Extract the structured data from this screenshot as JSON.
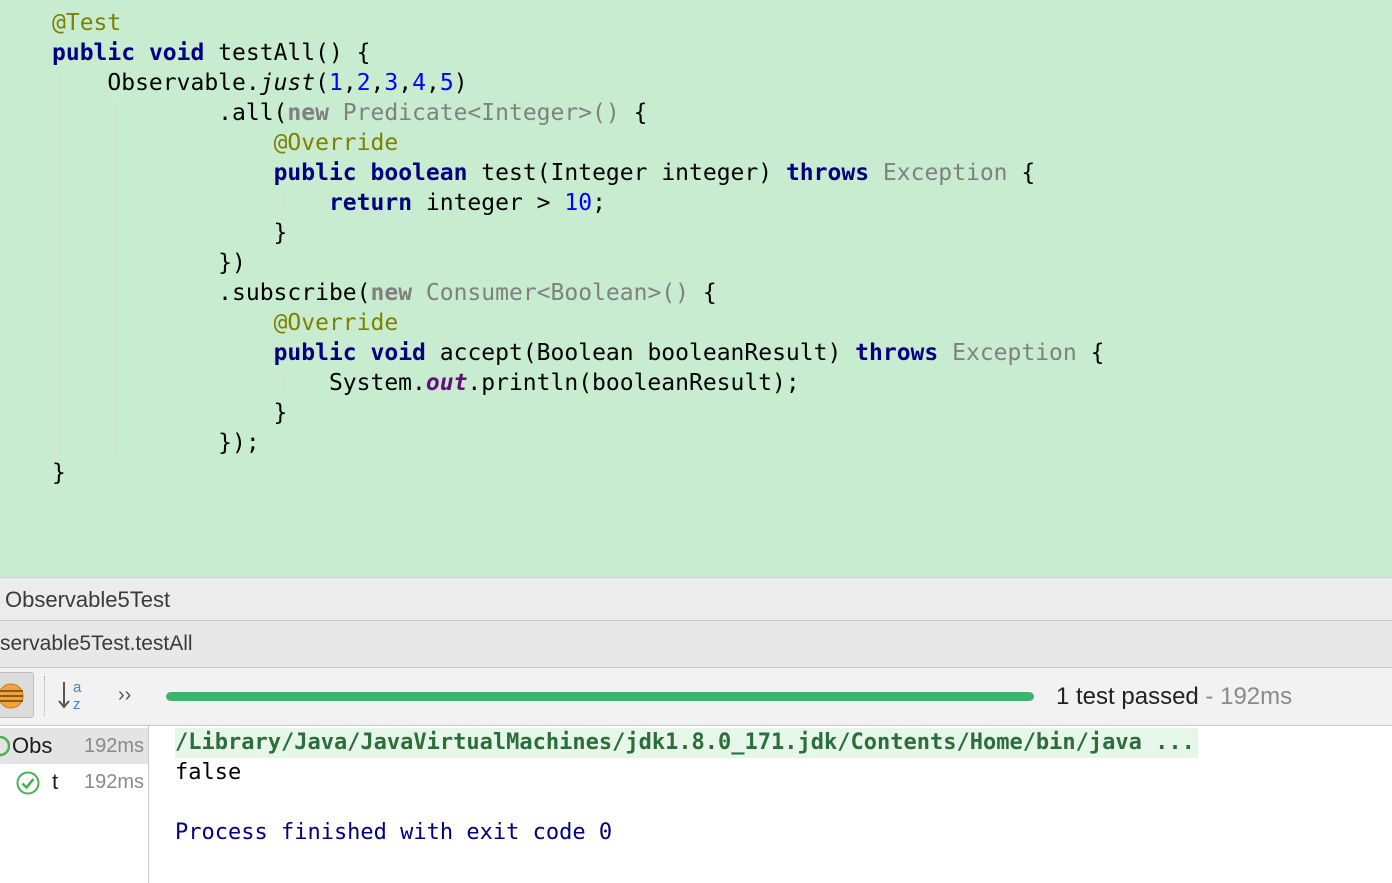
{
  "editor": {
    "lines": [
      [
        {
          "t": "@Test",
          "c": "ann"
        }
      ],
      [
        {
          "t": "public",
          "c": "kw"
        },
        {
          "t": " "
        },
        {
          "t": "void",
          "c": "kw"
        },
        {
          "t": " testAll() {"
        }
      ],
      [
        {
          "t": "    Observable."
        },
        {
          "t": "just",
          "c": "italic"
        },
        {
          "t": "("
        },
        {
          "t": "1",
          "c": "num"
        },
        {
          "t": ","
        },
        {
          "t": "2",
          "c": "num"
        },
        {
          "t": ","
        },
        {
          "t": "3",
          "c": "num"
        },
        {
          "t": ","
        },
        {
          "t": "4",
          "c": "num"
        },
        {
          "t": ","
        },
        {
          "t": "5",
          "c": "num"
        },
        {
          "t": ")"
        }
      ],
      [
        {
          "t": "            .all("
        },
        {
          "t": "new",
          "c": "kw-gray"
        },
        {
          "t": " Predicate<Integer>()",
          "c": "gray"
        },
        {
          "t": " {"
        }
      ],
      [
        {
          "t": "                "
        },
        {
          "t": "@Override",
          "c": "ann"
        }
      ],
      [
        {
          "t": "                "
        },
        {
          "t": "public",
          "c": "kw"
        },
        {
          "t": " "
        },
        {
          "t": "boolean",
          "c": "kw"
        },
        {
          "t": " test(Integer integer) "
        },
        {
          "t": "throws",
          "c": "kw"
        },
        {
          "t": " "
        },
        {
          "t": "Exception",
          "c": "gray"
        },
        {
          "t": " {"
        }
      ],
      [
        {
          "t": "                    "
        },
        {
          "t": "return",
          "c": "kw"
        },
        {
          "t": " integer > "
        },
        {
          "t": "10",
          "c": "num"
        },
        {
          "t": ";"
        }
      ],
      [
        {
          "t": "                }"
        }
      ],
      [
        {
          "t": "            })"
        }
      ],
      [
        {
          "t": "            .subscribe("
        },
        {
          "t": "new",
          "c": "kw-gray"
        },
        {
          "t": " Consumer<Boolean>()",
          "c": "gray"
        },
        {
          "t": " {"
        }
      ],
      [
        {
          "t": "                "
        },
        {
          "t": "@Override",
          "c": "ann"
        }
      ],
      [
        {
          "t": "                "
        },
        {
          "t": "public",
          "c": "kw"
        },
        {
          "t": " "
        },
        {
          "t": "void",
          "c": "kw"
        },
        {
          "t": " accept(Boolean booleanResult) "
        },
        {
          "t": "throws",
          "c": "kw"
        },
        {
          "t": " "
        },
        {
          "t": "Exception",
          "c": "gray"
        },
        {
          "t": " {"
        }
      ],
      [
        {
          "t": "                    System."
        },
        {
          "t": "out",
          "c": "field"
        },
        {
          "t": ".println(booleanResult);"
        }
      ],
      [
        {
          "t": "                }"
        }
      ],
      [
        {
          "t": "            });"
        }
      ],
      [
        {
          "t": "}"
        }
      ]
    ]
  },
  "run_panel": {
    "title": "Observable5Test",
    "tab_label": "servable5Test.testAll",
    "status": {
      "passed": "1 test passed",
      "duration": " - 192ms",
      "progress_fraction": 1.0
    },
    "tree": [
      {
        "name": "Obs",
        "time": "192ms",
        "icon": "test-suite-passed-icon"
      },
      {
        "name": "t",
        "time": "192ms",
        "icon": "test-passed-check-icon"
      }
    ],
    "console": {
      "command": "/Library/Java/JavaVirtualMachines/jdk1.8.0_171.jdk/Contents/Home/bin/java ...",
      "stdout": "false",
      "exit": "Process finished with exit code 0"
    }
  },
  "colors": {
    "editor_background": "#c7ecd0",
    "keyword": "#000080",
    "annotation": "#808000",
    "number": "#0000ff",
    "progress_pass": "#3db46d",
    "check": "#4caf50"
  }
}
